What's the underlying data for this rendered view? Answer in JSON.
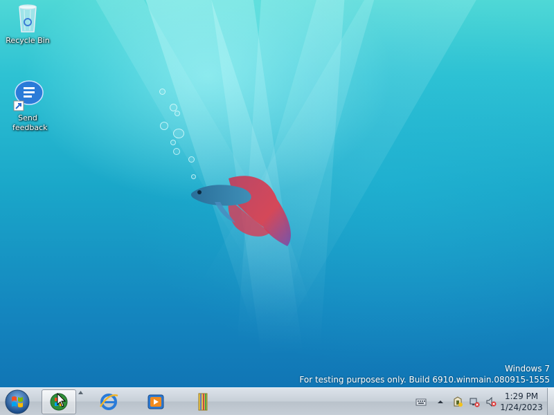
{
  "desktop": {
    "icons": [
      {
        "label": "Recycle Bin",
        "icon": "recycle-bin-icon"
      },
      {
        "label": "Send feedback",
        "icon": "feedback-icon"
      }
    ],
    "watermark": {
      "line1": "Windows  7",
      "line2": "For testing purposes only. Build 6910.winmain.080915-1555"
    }
  },
  "taskbar": {
    "start_icon": "windows-orb-icon",
    "pinned": [
      {
        "icon": "windows-explorer-icon",
        "active": true
      },
      {
        "icon": "internet-explorer-icon",
        "active": false
      },
      {
        "icon": "media-player-icon",
        "active": false
      },
      {
        "icon": "library-folder-icon",
        "active": false
      }
    ],
    "tray": {
      "icons": [
        "keyboard-icon",
        "show-hidden-icons-chevron",
        "action-center-icon",
        "network-icon",
        "volume-muted-icon"
      ],
      "time": "1:29 PM",
      "date": "1/24/2023"
    }
  },
  "colors": {
    "wallpaper_top": "#4fd8d6",
    "wallpaper_bottom": "#0f6fb1",
    "taskbar": "#c8d0d8"
  }
}
